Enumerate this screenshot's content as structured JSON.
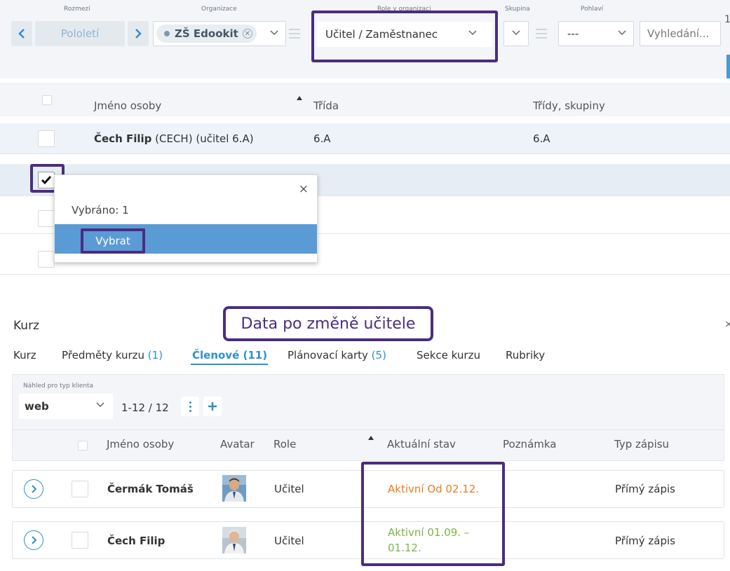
{
  "filters": {
    "range_label": "Rozmezí",
    "range_value": "Pololetí",
    "org_label": "Organizace",
    "org_value": "ZŠ Edookit",
    "role_label": "Role v organizaci",
    "role_value": "Učitel / Zaměstnanec",
    "group_label": "Skupina",
    "gender_label": "Pohlaví",
    "gender_value": "---",
    "search_placeholder": "Vyhledání...",
    "overflow_char": "1"
  },
  "table": {
    "col_name": "Jméno osoby",
    "col_class": "Třída",
    "col_classes_groups": "Třídy, skupiny",
    "rows": [
      {
        "name": "Čech Filip",
        "code": " (CECH)",
        "note": " (učitel 6.A)",
        "class": "6.A",
        "groups": "6.A"
      }
    ]
  },
  "popup": {
    "selected_text": "Vybráno: 1",
    "select_button": "Vybrat",
    "close": "×"
  },
  "course": {
    "title": "Kurz",
    "callout": "Data po změně učitele",
    "tabs": {
      "kurz": "Kurz",
      "predmety": "Předměty kurzu",
      "predmety_count": "(1)",
      "clenove": "Členové",
      "clenove_count": "(11)",
      "karty": "Plánovací karty",
      "karty_count": "(5)",
      "sekce": "Sekce kurzu",
      "rubriky": "Rubriky"
    },
    "preview_label": "Náhled pro typ klienta",
    "client_type": "web",
    "pagination": "1-12 / 12",
    "columns": {
      "name": "Jméno osoby",
      "avatar": "Avatar",
      "role": "Role",
      "status": "Aktuální stav",
      "note": "Poznámka",
      "enroll": "Typ zápisu"
    },
    "members": [
      {
        "name": "Čermák Tomáš",
        "role": "Učitel",
        "status_line1": "Aktivní Od 02.12.",
        "status_line2": "",
        "enroll": "Přímý zápis"
      },
      {
        "name": "Čech Filip",
        "role": "Učitel",
        "status_line1": "Aktivní 01.09. –",
        "status_line2": "01.12.",
        "enroll": "Přímý zápis"
      }
    ]
  },
  "colors": {
    "highlight": "#4b2d7f",
    "accent_blue": "#2e8fd0",
    "status_orange": "#e67e22",
    "status_green": "#7ab648",
    "select_blue": "#5b9bd5"
  }
}
